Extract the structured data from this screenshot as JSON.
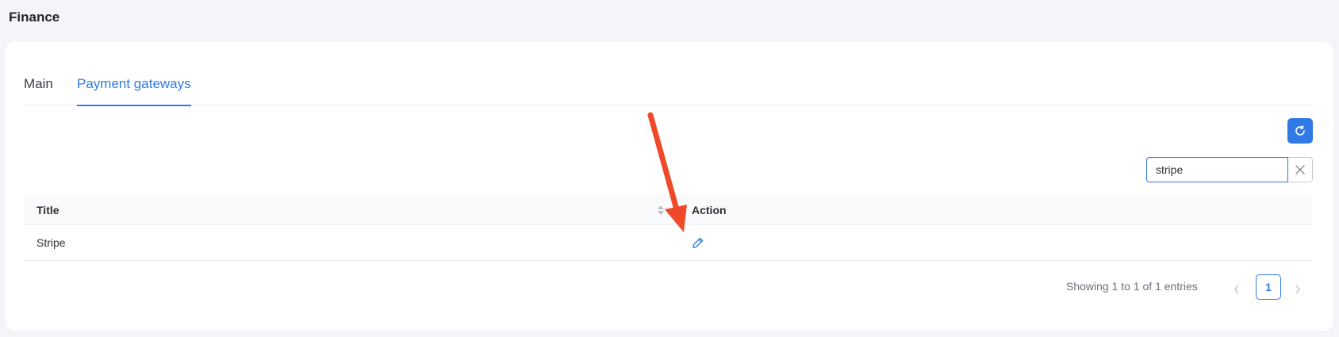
{
  "page": {
    "title": "Finance"
  },
  "tabs": [
    {
      "label": "Main",
      "active": false
    },
    {
      "label": "Payment gateways",
      "active": true
    }
  ],
  "toolbar": {
    "refresh_icon": "refresh-icon"
  },
  "search": {
    "value": "stripe",
    "clear_icon": "close-icon"
  },
  "table": {
    "columns": [
      "Title",
      "Action"
    ],
    "rows": [
      {
        "title": "Stripe",
        "action_icon": "pencil-icon"
      }
    ]
  },
  "pagination": {
    "info": "Showing 1 to 1 of 1 entries",
    "current_page": "1"
  },
  "colors": {
    "accent": "#2f7ae5",
    "annotation_arrow": "#ee4a2a"
  }
}
